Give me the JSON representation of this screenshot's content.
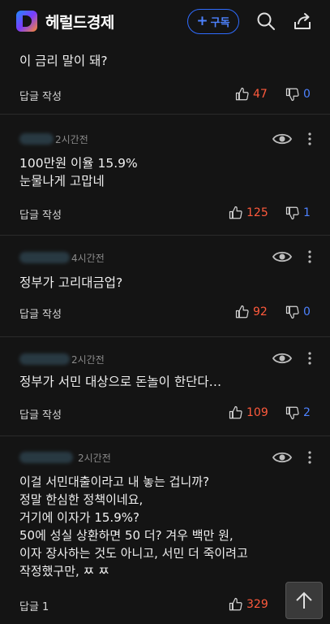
{
  "header": {
    "brand": "헤럴드경제",
    "subscribe_label": "구독",
    "subscribe_plus": "+"
  },
  "comments": [
    {
      "time": "",
      "text": "이 금리 말이 돼?",
      "reply": "답글 작성",
      "likes": "47",
      "dislikes": "0"
    },
    {
      "time": "2시간전",
      "text": "100만원 이율 15.9%\n눈물나게 고맙네",
      "reply": "답글 작성",
      "likes": "125",
      "dislikes": "1"
    },
    {
      "time": "4시간전",
      "text": "정부가 고리대금업?",
      "reply": "답글 작성",
      "likes": "92",
      "dislikes": "0"
    },
    {
      "time": "2시간전",
      "text": "정부가 서민 대상으로 돈놀이 한단다…",
      "reply": "답글 작성",
      "likes": "109",
      "dislikes": "2"
    },
    {
      "time": "2시간전",
      "text": "이걸 서민대출이라고 내 놓는 겁니까?\n정말 한심한 정책이네요,\n거기에 이자가 15.9%?\n50에 성실 상환하면 50 더? 겨우 백만 원,\n이자 장사하는 것도 아니고, 서민 더 죽이려고\n작정했구만, ㅉ ㅉ",
      "reply": "답글 1",
      "likes": "329",
      "dislikes": ""
    }
  ],
  "colors": {
    "background": "#141414",
    "like": "#ff5a3c",
    "dislike": "#4d82ff",
    "subscribe": "#2f6cff"
  }
}
